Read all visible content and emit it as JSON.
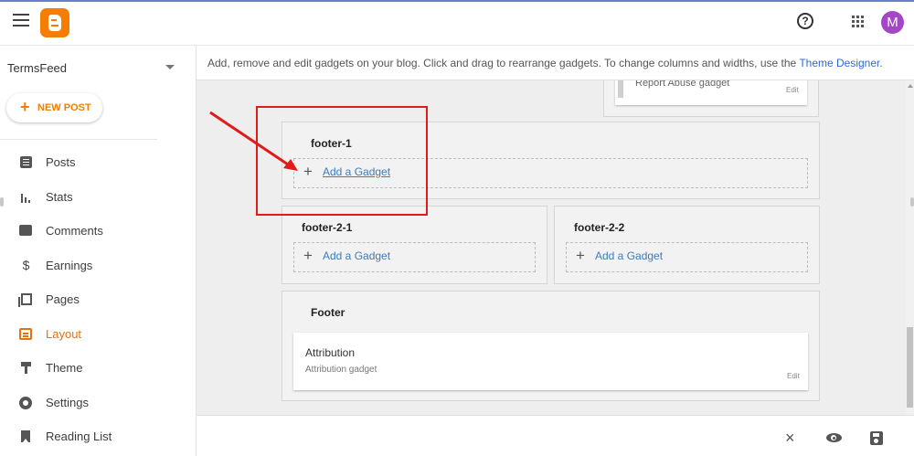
{
  "header": {
    "menu_icon": "hamburger-menu-icon",
    "logo_icon": "blogger-logo",
    "help_icon": "help-icon",
    "help_symbol": "?",
    "apps_icon": "apps-grid-icon",
    "avatar_initial": "M",
    "accent_color": "#f57d00"
  },
  "sidebar": {
    "blog_name": "TermsFeed",
    "new_post_label": "NEW POST",
    "new_post_plus": "+",
    "items": [
      {
        "label": "Posts",
        "icon": "posts-icon",
        "active": false
      },
      {
        "label": "Stats",
        "icon": "stats-icon",
        "active": false
      },
      {
        "label": "Comments",
        "icon": "comments-icon",
        "active": false
      },
      {
        "label": "Earnings",
        "icon": "dollar-icon",
        "symbol": "$",
        "active": false
      },
      {
        "label": "Pages",
        "icon": "pages-icon",
        "active": false
      },
      {
        "label": "Layout",
        "icon": "layout-icon",
        "active": true
      },
      {
        "label": "Theme",
        "icon": "paint-roller-icon",
        "active": false
      },
      {
        "label": "Settings",
        "icon": "gear-icon",
        "active": false
      },
      {
        "label": "Reading List",
        "icon": "bookmark-icon",
        "active": false
      }
    ]
  },
  "main": {
    "info_text": "Add, remove and edit gadgets on your blog. Click and drag to rearrange gadgets. To change columns and widths, use the",
    "info_link": "Theme Designer",
    "info_end": ".",
    "report_abuse": {
      "name": "Report Abuse gadget",
      "edit": "Edit"
    },
    "sections": {
      "footer_1": {
        "title": "footer-1",
        "add_label": "Add a Gadget",
        "plus": "+"
      },
      "footer_2_1": {
        "title": "footer-2-1",
        "add_label": "Add a Gadget",
        "plus": "+"
      },
      "footer_2_2": {
        "title": "footer-2-2",
        "add_label": "Add a Gadget",
        "plus": "+"
      },
      "footer": {
        "title": "Footer",
        "gadget": {
          "name": "Attribution",
          "sub": "Attribution gadget",
          "edit": "Edit"
        }
      }
    }
  },
  "bottom_bar": {
    "close_symbol": "×",
    "close_icon": "close-icon",
    "preview_icon": "eye-icon",
    "save_icon": "save-icon"
  },
  "annotation": {
    "highlight_color": "#e01b1b"
  }
}
